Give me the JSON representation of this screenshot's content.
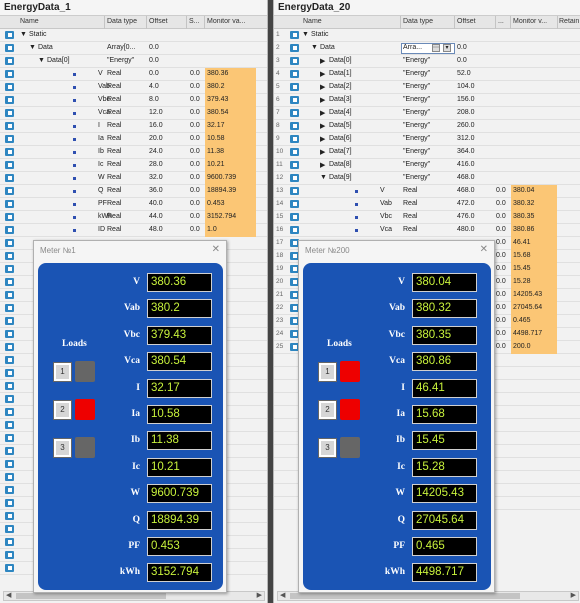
{
  "left": {
    "title": "EnergyData_1",
    "columns": {
      "name": "Name",
      "dtype": "Data type",
      "offset": "Offset",
      "s": "S...",
      "monitor": "Monitor va..."
    },
    "rows": [
      {
        "level": 0,
        "arrow": "▼",
        "name": "Static",
        "dtype": "",
        "offset": "",
        "s": "",
        "mon": ""
      },
      {
        "level": 1,
        "arrow": "▼",
        "name": "Data",
        "dtype": "Array[0...",
        "offset": "0.0",
        "s": "",
        "mon": ""
      },
      {
        "level": 2,
        "arrow": "▼",
        "name": "Data[0]",
        "dtype": "\"Energy\"",
        "offset": "0.0",
        "s": "",
        "mon": ""
      },
      {
        "level": 3,
        "arrow": "",
        "name": "V",
        "dtype": "Real",
        "offset": "0.0",
        "s": "0.0",
        "mon": "380.36"
      },
      {
        "level": 3,
        "arrow": "",
        "name": "Vab",
        "dtype": "Real",
        "offset": "4.0",
        "s": "0.0",
        "mon": "380.2"
      },
      {
        "level": 3,
        "arrow": "",
        "name": "Vbc",
        "dtype": "Real",
        "offset": "8.0",
        "s": "0.0",
        "mon": "379.43"
      },
      {
        "level": 3,
        "arrow": "",
        "name": "Vca",
        "dtype": "Real",
        "offset": "12.0",
        "s": "0.0",
        "mon": "380.54"
      },
      {
        "level": 3,
        "arrow": "",
        "name": "I",
        "dtype": "Real",
        "offset": "16.0",
        "s": "0.0",
        "mon": "32.17"
      },
      {
        "level": 3,
        "arrow": "",
        "name": "Ia",
        "dtype": "Real",
        "offset": "20.0",
        "s": "0.0",
        "mon": "10.58"
      },
      {
        "level": 3,
        "arrow": "",
        "name": "Ib",
        "dtype": "Real",
        "offset": "24.0",
        "s": "0.0",
        "mon": "11.38"
      },
      {
        "level": 3,
        "arrow": "",
        "name": "Ic",
        "dtype": "Real",
        "offset": "28.0",
        "s": "0.0",
        "mon": "10.21"
      },
      {
        "level": 3,
        "arrow": "",
        "name": "W",
        "dtype": "Real",
        "offset": "32.0",
        "s": "0.0",
        "mon": "9600.739"
      },
      {
        "level": 3,
        "arrow": "",
        "name": "Q",
        "dtype": "Real",
        "offset": "36.0",
        "s": "0.0",
        "mon": "18894.39"
      },
      {
        "level": 3,
        "arrow": "",
        "name": "PF",
        "dtype": "Real",
        "offset": "40.0",
        "s": "0.0",
        "mon": "0.453"
      },
      {
        "level": 3,
        "arrow": "",
        "name": "kWh",
        "dtype": "Real",
        "offset": "44.0",
        "s": "0.0",
        "mon": "3152.794"
      },
      {
        "level": 3,
        "arrow": "",
        "name": "ID",
        "dtype": "Real",
        "offset": "48.0",
        "s": "0.0",
        "mon": "1.0"
      }
    ],
    "extra_rows": 26
  },
  "right": {
    "title": "EnergyData_20",
    "columns": {
      "name": "Name",
      "dtype": "Data type",
      "offset": "Offset",
      "s": "...",
      "monitor": "Monitor v...",
      "retain": "Retain"
    },
    "rows": [
      {
        "n": "1",
        "level": 0,
        "arrow": "▼",
        "name": "Static",
        "dtype": "",
        "offset": "",
        "mon": ""
      },
      {
        "n": "2",
        "level": 1,
        "arrow": "▼",
        "name": "Data",
        "dtype": "Arra...",
        "offset": "0.0",
        "mon": "",
        "editing": true
      },
      {
        "n": "3",
        "level": 2,
        "arrow": "▶",
        "name": "Data[0]",
        "dtype": "\"Energy\"",
        "offset": "0.0",
        "mon": ""
      },
      {
        "n": "4",
        "level": 2,
        "arrow": "▶",
        "name": "Data[1]",
        "dtype": "\"Energy\"",
        "offset": "52.0",
        "mon": ""
      },
      {
        "n": "5",
        "level": 2,
        "arrow": "▶",
        "name": "Data[2]",
        "dtype": "\"Energy\"",
        "offset": "104.0",
        "mon": ""
      },
      {
        "n": "6",
        "level": 2,
        "arrow": "▶",
        "name": "Data[3]",
        "dtype": "\"Energy\"",
        "offset": "156.0",
        "mon": ""
      },
      {
        "n": "7",
        "level": 2,
        "arrow": "▶",
        "name": "Data[4]",
        "dtype": "\"Energy\"",
        "offset": "208.0",
        "mon": ""
      },
      {
        "n": "8",
        "level": 2,
        "arrow": "▶",
        "name": "Data[5]",
        "dtype": "\"Energy\"",
        "offset": "260.0",
        "mon": ""
      },
      {
        "n": "9",
        "level": 2,
        "arrow": "▶",
        "name": "Data[6]",
        "dtype": "\"Energy\"",
        "offset": "312.0",
        "mon": ""
      },
      {
        "n": "10",
        "level": 2,
        "arrow": "▶",
        "name": "Data[7]",
        "dtype": "\"Energy\"",
        "offset": "364.0",
        "mon": ""
      },
      {
        "n": "11",
        "level": 2,
        "arrow": "▶",
        "name": "Data[8]",
        "dtype": "\"Energy\"",
        "offset": "416.0",
        "mon": ""
      },
      {
        "n": "12",
        "level": 2,
        "arrow": "▼",
        "name": "Data[9]",
        "dtype": "\"Energy\"",
        "offset": "468.0",
        "mon": ""
      },
      {
        "n": "13",
        "level": 3,
        "arrow": "",
        "name": "V",
        "dtype": "Real",
        "offset": "468.0",
        "s": "0.0",
        "mon": "380.04"
      },
      {
        "n": "14",
        "level": 3,
        "arrow": "",
        "name": "Vab",
        "dtype": "Real",
        "offset": "472.0",
        "s": "0.0",
        "mon": "380.32"
      },
      {
        "n": "15",
        "level": 3,
        "arrow": "",
        "name": "Vbc",
        "dtype": "Real",
        "offset": "476.0",
        "s": "0.0",
        "mon": "380.35"
      },
      {
        "n": "16",
        "level": 3,
        "arrow": "",
        "name": "Vca",
        "dtype": "Real",
        "offset": "480.0",
        "s": "0.0",
        "mon": "380.86"
      },
      {
        "n": "17",
        "level": 3,
        "arrow": "",
        "name": "",
        "dtype": "",
        "offset": "",
        "s": "0.0",
        "mon": "46.41"
      },
      {
        "n": "18",
        "level": 3,
        "arrow": "",
        "name": "",
        "dtype": "",
        "offset": "",
        "s": "0.0",
        "mon": "15.68"
      },
      {
        "n": "19",
        "level": 3,
        "arrow": "",
        "name": "",
        "dtype": "",
        "offset": "",
        "s": "0.0",
        "mon": "15.45"
      },
      {
        "n": "20",
        "level": 3,
        "arrow": "",
        "name": "",
        "dtype": "",
        "offset": "",
        "s": "0.0",
        "mon": "15.28"
      },
      {
        "n": "21",
        "level": 3,
        "arrow": "",
        "name": "",
        "dtype": "",
        "offset": "",
        "s": "0.0",
        "mon": "14205.43"
      },
      {
        "n": "22",
        "level": 3,
        "arrow": "",
        "name": "",
        "dtype": "",
        "offset": "",
        "s": "0.0",
        "mon": "27045.64"
      },
      {
        "n": "23",
        "level": 3,
        "arrow": "",
        "name": "",
        "dtype": "",
        "offset": "",
        "s": "0.0",
        "mon": "0.465"
      },
      {
        "n": "24",
        "level": 3,
        "arrow": "",
        "name": "",
        "dtype": "",
        "offset": "",
        "s": "0.0",
        "mon": "4498.717"
      },
      {
        "n": "25",
        "level": 3,
        "arrow": "",
        "name": "",
        "dtype": "",
        "offset": "",
        "s": "0.0",
        "mon": "200.0"
      }
    ],
    "extra_rows": 12
  },
  "meters": [
    {
      "title": "Meter №1",
      "loads_title": "Loads",
      "loads": [
        {
          "n": "1",
          "color": "#666666"
        },
        {
          "n": "2",
          "color": "#ee0000"
        },
        {
          "n": "3",
          "color": "#666666"
        }
      ],
      "params": [
        {
          "label": "V",
          "value": "380.36"
        },
        {
          "label": "Vab",
          "value": "380.2"
        },
        {
          "label": "Vbc",
          "value": "379.43"
        },
        {
          "label": "Vca",
          "value": "380.54"
        },
        {
          "label": "I",
          "value": "32.17"
        },
        {
          "label": "Ia",
          "value": "10.58"
        },
        {
          "label": "Ib",
          "value": "11.38"
        },
        {
          "label": "Ic",
          "value": "10.21"
        },
        {
          "label": "W",
          "value": "9600.739"
        },
        {
          "label": "Q",
          "value": "18894.39"
        },
        {
          "label": "PF",
          "value": "0.453"
        },
        {
          "label": "kWh",
          "value": "3152.794"
        }
      ]
    },
    {
      "title": "Meter №200",
      "loads_title": "Loads",
      "loads": [
        {
          "n": "1",
          "color": "#ee0000"
        },
        {
          "n": "2",
          "color": "#ee0000"
        },
        {
          "n": "3",
          "color": "#666666"
        }
      ],
      "params": [
        {
          "label": "V",
          "value": "380.04"
        },
        {
          "label": "Vab",
          "value": "380.32"
        },
        {
          "label": "Vbc",
          "value": "380.35"
        },
        {
          "label": "Vca",
          "value": "380.86"
        },
        {
          "label": "I",
          "value": "46.41"
        },
        {
          "label": "Ia",
          "value": "15.68"
        },
        {
          "label": "Ib",
          "value": "15.45"
        },
        {
          "label": "Ic",
          "value": "15.28"
        },
        {
          "label": "W",
          "value": "14205.43"
        },
        {
          "label": "Q",
          "value": "27045.64"
        },
        {
          "label": "PF",
          "value": "0.465"
        },
        {
          "label": "kWh",
          "value": "4498.717"
        }
      ]
    }
  ]
}
